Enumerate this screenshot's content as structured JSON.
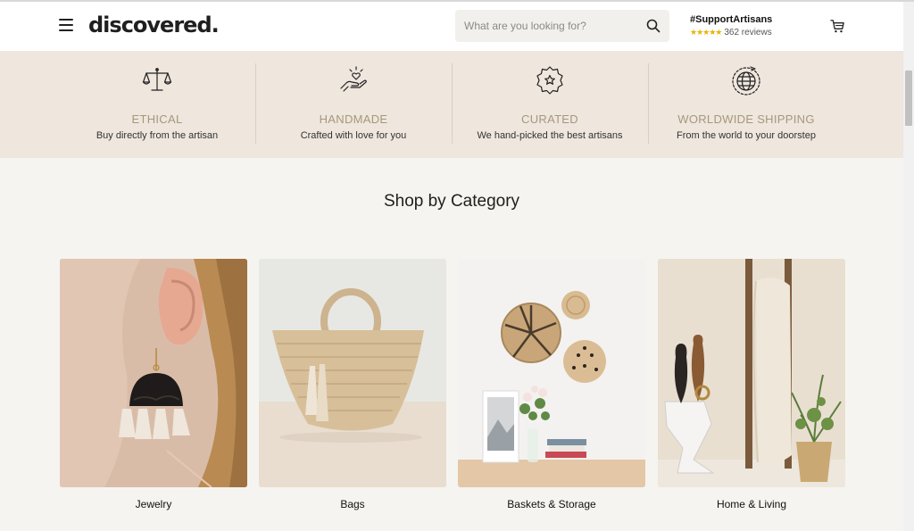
{
  "header": {
    "logo": "discovered.",
    "search_placeholder": "What are you looking for?",
    "support_tag": "#SupportArtisans",
    "rating_stars": "★★★★★",
    "reviews": "362 reviews"
  },
  "features": [
    {
      "icon": "scales-icon",
      "title": "ETHICAL",
      "desc": "Buy directly from the artisan"
    },
    {
      "icon": "hand-heart-icon",
      "title": "HANDMADE",
      "desc": "Crafted with love for you"
    },
    {
      "icon": "star-badge-icon",
      "title": "CURATED",
      "desc": "We hand-picked the best artisans"
    },
    {
      "icon": "globe-icon",
      "title": "WORLDWIDE SHIPPING",
      "desc": "From the world to your doorstep"
    }
  ],
  "section_title": "Shop by Category",
  "categories": [
    {
      "label": "Jewelry"
    },
    {
      "label": "Bags"
    },
    {
      "label": "Baskets & Storage"
    },
    {
      "label": "Home & Living"
    }
  ],
  "colors": {
    "accent_title": "#a5997a",
    "band": "#efe6de",
    "background": "#f6f4f0",
    "stars": "#e9b400"
  }
}
